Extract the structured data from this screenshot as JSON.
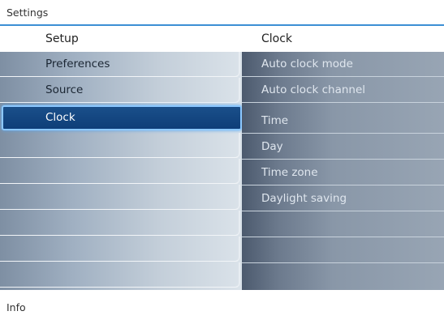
{
  "window": {
    "title": "Settings"
  },
  "header": {
    "left_title": "Setup",
    "right_title": "Clock"
  },
  "left_menu": {
    "items": [
      {
        "label": "Preferences",
        "selected": false
      },
      {
        "label": "Source",
        "selected": false
      },
      {
        "label": "Clock",
        "selected": true
      },
      {
        "label": ""
      },
      {
        "label": ""
      },
      {
        "label": ""
      },
      {
        "label": ""
      },
      {
        "label": ""
      },
      {
        "label": ""
      }
    ]
  },
  "right_menu": {
    "items": [
      {
        "label": "Auto clock mode"
      },
      {
        "label": "Auto clock channel"
      },
      {
        "label": "Time"
      },
      {
        "label": "Day"
      },
      {
        "label": "Time zone"
      },
      {
        "label": "Daylight saving"
      },
      {
        "label": ""
      },
      {
        "label": ""
      },
      {
        "label": ""
      }
    ]
  },
  "footer": {
    "info_label": "Info"
  },
  "colors": {
    "accent": "#3c8fd4",
    "selected_bg": "#0e3e78",
    "selected_border": "#8cc8ff"
  }
}
